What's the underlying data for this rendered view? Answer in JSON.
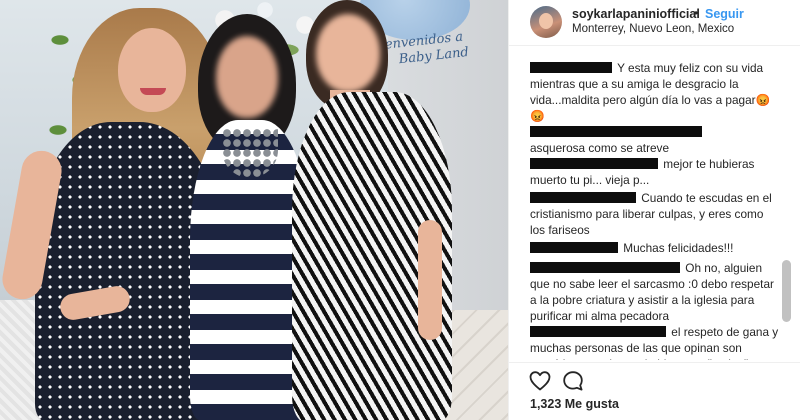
{
  "post": {
    "username": "soykarlapaniniofficial",
    "separator": "•",
    "follow_label": "Seguir",
    "location": "Monterrey, Nuevo Leon, Mexico"
  },
  "photo": {
    "banner_line1": "Bienvenidos a",
    "banner_line2": "Baby Land"
  },
  "comments": [
    {
      "text": "Y esta muy feliz con su vida mientras que a su amiga le desgracio la vida...maldita pero algún día lo vas a pagar😡😡"
    },
    {
      "text": "asquerosa como se atreve"
    },
    {
      "text": "mejor te hubieras muerto tu pi... vieja p..."
    },
    {
      "text": "Cuando te escudas en el cristianismo para liberar culpas, y eres como los fariseos"
    },
    {
      "text": "Muchas felicidades!!!"
    },
    {
      "text": "Oh no, alguien que no sabe leer el sarcasmo :0 debo respetar a la pobre criatura y asistir a la iglesia para purificar mi alma pecadora"
    },
    {
      "text": "el respeto de gana y muchas personas de las que opinan son empáticas con lo que le hizo a su \"amiga\""
    }
  ],
  "actions": {
    "like_icon": "heart-icon",
    "comment_icon": "comment-bubble-icon",
    "likes_text": "1,323 Me gusta"
  },
  "colors": {
    "accent": "#3897f0",
    "text": "#262626",
    "border": "#efefef"
  }
}
